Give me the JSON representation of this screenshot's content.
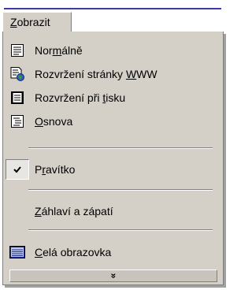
{
  "menu": {
    "title_pre": "",
    "title_ul": "Z",
    "title_post": "obrazit"
  },
  "items": [
    {
      "pre": "Nor",
      "ul": "m",
      "post": "álně",
      "icon": "normal-view-icon"
    },
    {
      "pre": "Rozvržení stránky ",
      "ul": "W",
      "post": "WW",
      "icon": "web-layout-icon"
    },
    {
      "pre": "Rozvržení při ",
      "ul": "t",
      "post": "isku",
      "icon": "print-layout-icon"
    },
    {
      "pre": "",
      "ul": "O",
      "post": "snova",
      "icon": "outline-view-icon"
    },
    {
      "pre": "P",
      "ul": "r",
      "post": "avítko",
      "icon": "checkmark-icon",
      "checked": true
    },
    {
      "pre": "",
      "ul": "Z",
      "post": "áhlaví a zápatí",
      "icon": ""
    },
    {
      "pre": "",
      "ul": "C",
      "post": "elá obrazovka",
      "icon": "full-screen-icon"
    }
  ],
  "expand": {
    "glyph": "»",
    "icon": "expand-chevron-icon"
  }
}
